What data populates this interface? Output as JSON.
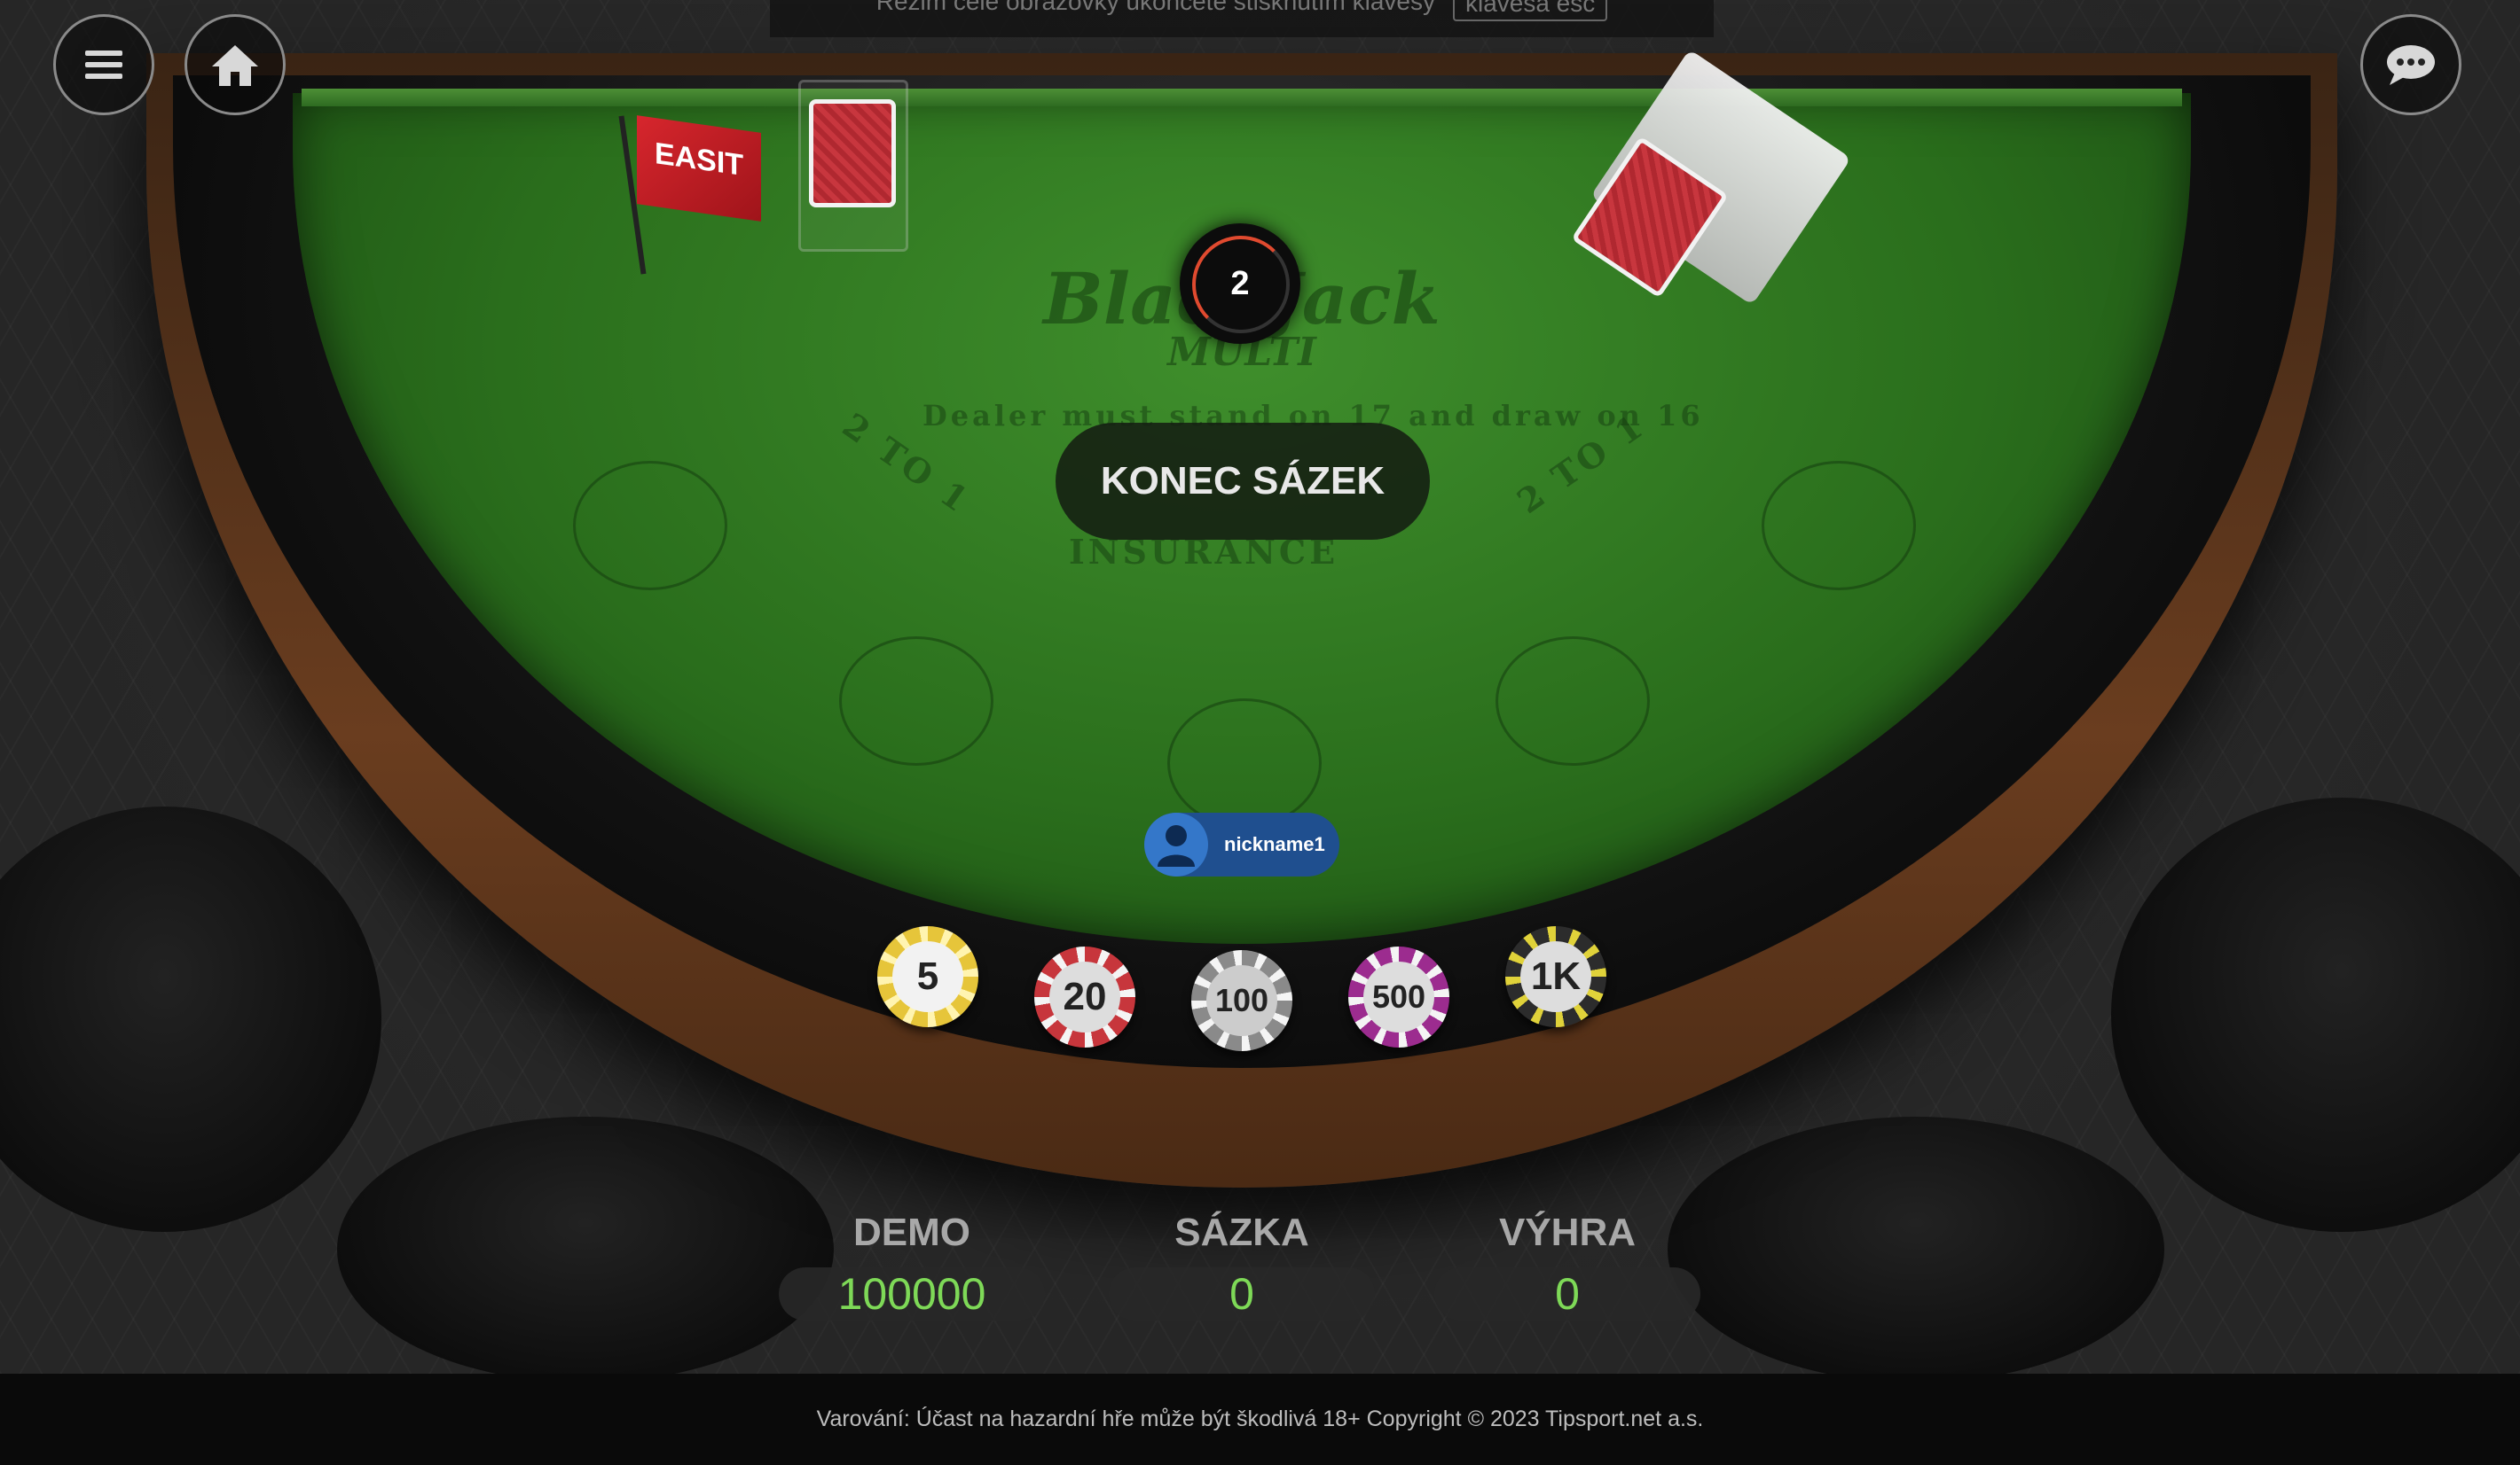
{
  "top_notice": {
    "text": "Režim celé obrazovky ukončete stisknutím klávesy",
    "key": "klávesa esc"
  },
  "toolbar": {
    "menu_icon": "menu-icon",
    "home_icon": "home-icon",
    "chat_icon": "chat-icon"
  },
  "table": {
    "logo": "BlackJack",
    "logo_sub": "MULTI",
    "arc_text": "Dealer must stand on 17 and draw on 16",
    "insurance": "INSURANCE",
    "left_payout": "2 TO 1",
    "right_payout": "2 TO 1",
    "flag_brand": "EASIT"
  },
  "timer": {
    "value": "2"
  },
  "status_message": "KONEC SÁZEK",
  "player": {
    "nickname": "nickname1"
  },
  "chips": [
    {
      "label": "5",
      "color": "#e6c53a"
    },
    {
      "label": "20",
      "color": "#c7363c"
    },
    {
      "label": "100",
      "color": "#9a9a9a"
    },
    {
      "label": "500",
      "color": "#9c2c8f"
    },
    {
      "label": "1K",
      "color": "#2c2c2c"
    }
  ],
  "stats": {
    "demo_label": "DEMO",
    "demo_value": "100000",
    "bet_label": "SÁZKA",
    "bet_value": "0",
    "win_label": "VÝHRA",
    "win_value": "0"
  },
  "footer": "Varování: Účast na hazardní hře může být škodlivá 18+ Copyright © 2023 Tipsport.net a.s."
}
